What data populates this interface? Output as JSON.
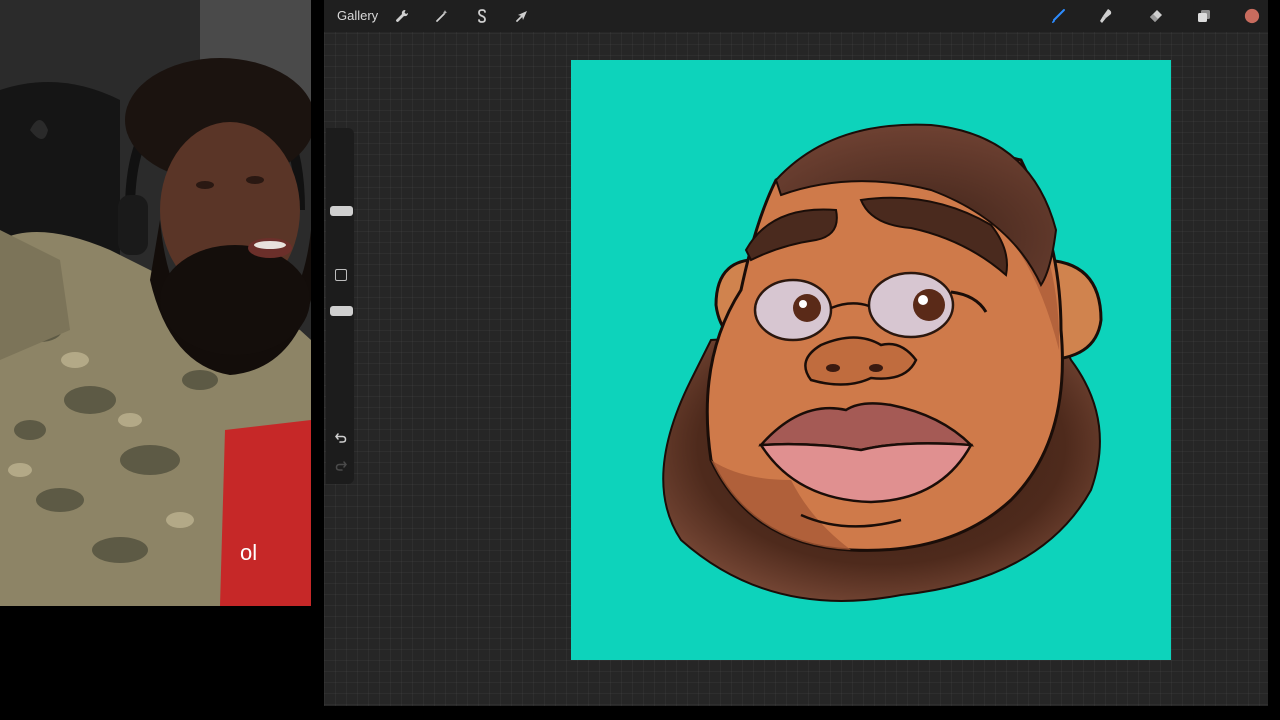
{
  "app": {
    "gallery_label": "Gallery",
    "toolbar_left": [
      {
        "name": "actions",
        "icon": "wrench-icon"
      },
      {
        "name": "adjustments",
        "icon": "magic-wand-icon"
      },
      {
        "name": "selection",
        "icon": "selection-s-icon"
      },
      {
        "name": "transform",
        "icon": "arrow-cursor-icon"
      }
    ],
    "toolbar_right": [
      {
        "name": "brush",
        "icon": "brush-icon",
        "active": true
      },
      {
        "name": "smudge",
        "icon": "smudge-icon"
      },
      {
        "name": "eraser",
        "icon": "eraser-icon"
      },
      {
        "name": "layers",
        "icon": "layers-icon"
      },
      {
        "name": "color",
        "icon": "color-swatch"
      }
    ],
    "active_color": "#c86c5e",
    "accent_color": "#2d8cff"
  },
  "canvas": {
    "background_color": "#0dd3bb"
  },
  "webcam": {
    "shirt_text": "ol"
  }
}
